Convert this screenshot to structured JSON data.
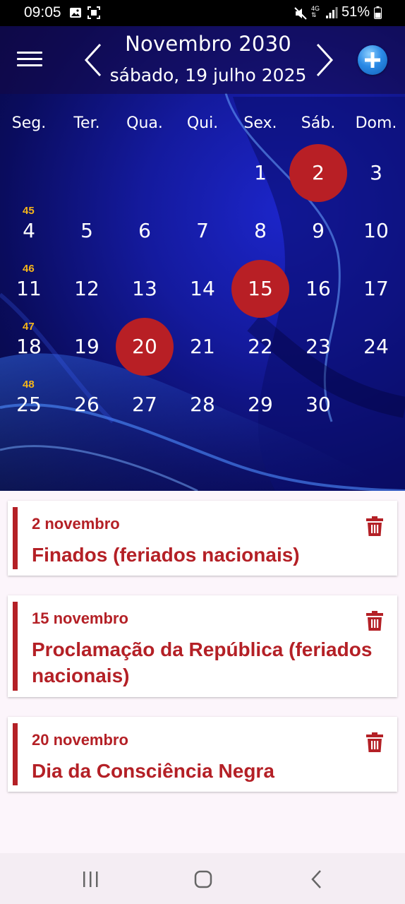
{
  "status_bar": {
    "time": "09:05",
    "battery": "51%",
    "icons": [
      "image-icon",
      "screenshot-icon",
      "mute-icon",
      "4g-icon",
      "signal-icon",
      "battery-icon"
    ]
  },
  "header": {
    "month_title": "Novembro 2030",
    "today_subtitle": "sábado, 19 julho 2025",
    "icons": [
      "menu-icon",
      "chevron-left-icon",
      "chevron-right-icon",
      "add-icon"
    ]
  },
  "calendar": {
    "weekdays": [
      "Seg.",
      "Ter.",
      "Qua.",
      "Qui.",
      "Sex.",
      "Sáb.",
      "Dom."
    ],
    "week_numbers": [
      "45",
      "46",
      "47",
      "48"
    ],
    "weeks": [
      [
        "",
        "",
        "",
        "",
        "1",
        "2",
        "3"
      ],
      [
        "4",
        "5",
        "6",
        "7",
        "8",
        "9",
        "10"
      ],
      [
        "11",
        "12",
        "13",
        "14",
        "15",
        "16",
        "17"
      ],
      [
        "18",
        "19",
        "20",
        "21",
        "22",
        "23",
        "24"
      ],
      [
        "25",
        "26",
        "27",
        "28",
        "29",
        "30",
        ""
      ]
    ],
    "holidays": [
      "2",
      "15",
      "20"
    ],
    "holiday_color": "#b81f25",
    "week_number_color": "#f5b51a"
  },
  "events": [
    {
      "date": "2 novembro",
      "title": "Finados (feriados nacionais)"
    },
    {
      "date": "15 novembro",
      "title": "Proclamação da República (feriados nacionais)"
    },
    {
      "date": "20 novembro",
      "title": "Dia da Consciência Negra"
    }
  ],
  "event_color": "#b42026",
  "bottom_nav": {
    "icons": [
      "recent-apps-icon",
      "home-icon",
      "back-icon"
    ]
  }
}
